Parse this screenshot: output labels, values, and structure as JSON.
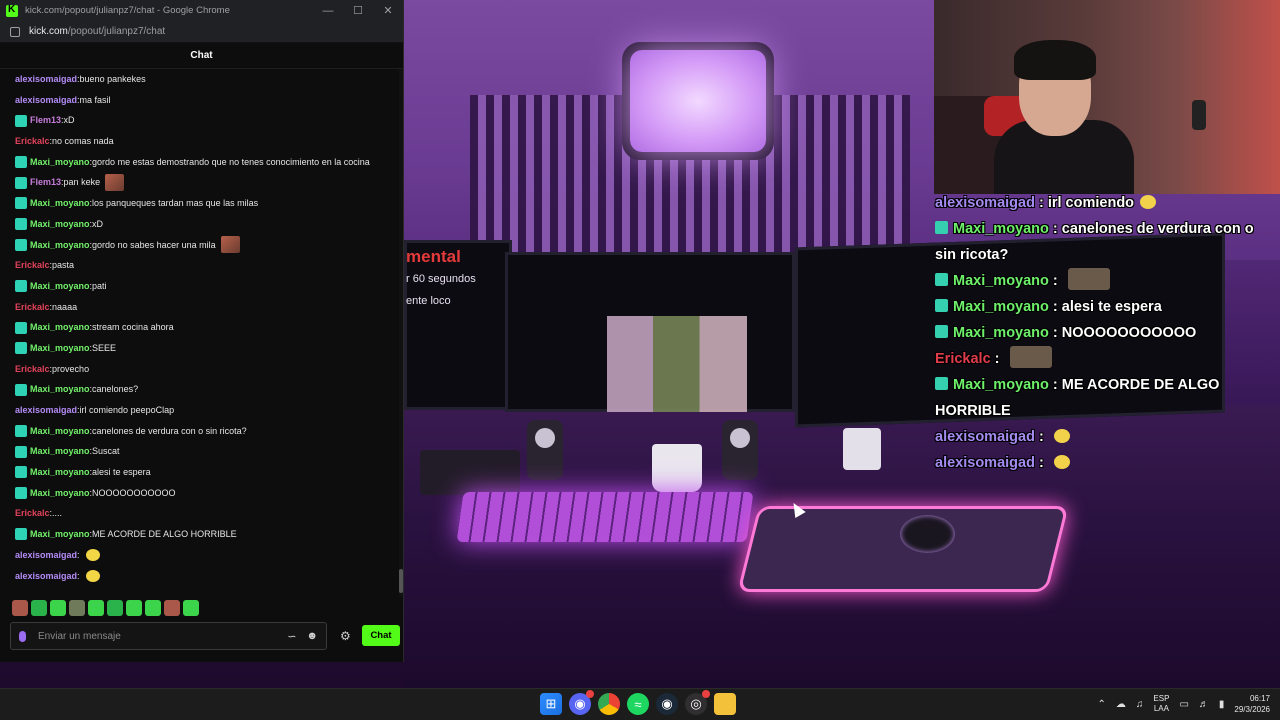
{
  "window": {
    "title": "kick.com/popout/julianpz7/chat - Google Chrome",
    "url_host": "kick.com",
    "url_path": "/popout/julianpz7/chat",
    "min_icon": "minimize-icon",
    "max_icon": "maximize-icon",
    "close_icon": "close-icon"
  },
  "chat": {
    "header": "Chat",
    "messages": [
      {
        "user": "alexisomaigad",
        "text": "bueno pankekes",
        "color": "purple",
        "badge": false,
        "emote": ""
      },
      {
        "user": "alexisomaigad",
        "text": "ma fasil",
        "color": "purple",
        "badge": false,
        "emote": ""
      },
      {
        "user": "Flem13",
        "text": "xD",
        "color": "pink",
        "badge": true,
        "emote": ""
      },
      {
        "user": "Erickalc",
        "text": "no comas nada",
        "color": "red",
        "badge": false,
        "emote": ""
      },
      {
        "user": "Maxi_moyano",
        "text": "gordo me estas demostrando que no tenes conocimiento en la cocina",
        "color": "green",
        "badge": true,
        "emote": ""
      },
      {
        "user": "Flem13",
        "text": "pan keke",
        "color": "pink",
        "badge": true,
        "emote": "img"
      },
      {
        "user": "Maxi_moyano",
        "text": "los panqueques tardan mas que las milas",
        "color": "green",
        "badge": true,
        "emote": ""
      },
      {
        "user": "Maxi_moyano",
        "text": "xD",
        "color": "green",
        "badge": true,
        "emote": ""
      },
      {
        "user": "Maxi_moyano",
        "text": "gordo no sabes hacer una mila",
        "color": "green",
        "badge": true,
        "emote": "img"
      },
      {
        "user": "Erickalc",
        "text": "pasta",
        "color": "red",
        "badge": false,
        "emote": ""
      },
      {
        "user": "Maxi_moyano",
        "text": "pati",
        "color": "green",
        "badge": true,
        "emote": ""
      },
      {
        "user": "Erickalc",
        "text": "naaaa",
        "color": "red",
        "badge": false,
        "emote": ""
      },
      {
        "user": "Maxi_moyano",
        "text": "stream cocina ahora",
        "color": "green",
        "badge": true,
        "emote": ""
      },
      {
        "user": "Maxi_moyano",
        "text": "SEEE",
        "color": "green",
        "badge": true,
        "emote": ""
      },
      {
        "user": "Erickalc",
        "text": "provecho",
        "color": "red",
        "badge": false,
        "emote": ""
      },
      {
        "user": "Maxi_moyano",
        "text": "canelones?",
        "color": "green",
        "badge": true,
        "emote": ""
      },
      {
        "user": "alexisomaigad",
        "text": "irl comiendo peepoClap",
        "color": "purple",
        "badge": false,
        "emote": ""
      },
      {
        "user": "Maxi_moyano",
        "text": "canelones de verdura con o sin ricota?",
        "color": "green",
        "badge": true,
        "emote": ""
      },
      {
        "user": "Maxi_moyano",
        "text": "Suscat",
        "color": "green",
        "badge": true,
        "emote": ""
      },
      {
        "user": "Maxi_moyano",
        "text": "alesi te espera",
        "color": "green",
        "badge": true,
        "emote": ""
      },
      {
        "user": "Maxi_moyano",
        "text": "NOOOOOOOOOOO",
        "color": "green",
        "badge": true,
        "emote": ""
      },
      {
        "user": "Erickalc",
        "text": "....",
        "color": "red",
        "badge": false,
        "emote": ""
      },
      {
        "user": "Maxi_moyano",
        "text": "ME ACORDE DE ALGO HORRIBLE",
        "color": "green",
        "badge": true,
        "emote": ""
      },
      {
        "user": "alexisomaigad",
        "text": "",
        "color": "purple",
        "badge": false,
        "emote": "yellow"
      },
      {
        "user": "alexisomaigad",
        "text": "",
        "color": "purple",
        "badge": false,
        "emote": "yellow"
      }
    ],
    "input_placeholder": "Enviar un mensaje",
    "send_label": "Chat",
    "mic_icon": "microphone-icon",
    "commands_icon": "commands-icon",
    "emoji_icon": "emoji-icon",
    "settings_icon": "gear-icon"
  },
  "stream": {
    "screen_text_1": "mental",
    "screen_text_2": "r 60 segundos",
    "screen_text_3": "ente loco",
    "overlay_chat": [
      {
        "user": "alexisomaigad",
        "text": "irl comiendo",
        "color": "purple",
        "badge": false,
        "emote": "yellow"
      },
      {
        "user": "Maxi_moyano",
        "text": "canelones de verdura con o sin ricota?",
        "color": "green",
        "badge": true,
        "emote": ""
      },
      {
        "user": "Maxi_moyano",
        "text": "",
        "color": "green",
        "badge": true,
        "emote": "img"
      },
      {
        "user": "Maxi_moyano",
        "text": "alesi te espera",
        "color": "green",
        "badge": true,
        "emote": ""
      },
      {
        "user": "Maxi_moyano",
        "text": "NOOOOOOOOOOO",
        "color": "green",
        "badge": true,
        "emote": ""
      },
      {
        "user": "Erickalc",
        "text": "",
        "color": "red",
        "badge": false,
        "emote": "img"
      },
      {
        "user": "Maxi_moyano",
        "text": "ME ACORDE DE ALGO HORRIBLE",
        "color": "green",
        "badge": true,
        "emote": ""
      },
      {
        "user": "alexisomaigad",
        "text": "",
        "color": "purple",
        "badge": false,
        "emote": "yellow"
      },
      {
        "user": "alexisomaigad",
        "text": "",
        "color": "purple",
        "badge": false,
        "emote": "yellow"
      }
    ]
  },
  "taskbar": {
    "apps": [
      "windows-start-icon",
      "discord-icon",
      "chrome-icon",
      "spotify-icon",
      "steam-icon",
      "obs-icon",
      "file-explorer-icon"
    ],
    "lang_top": "ESP",
    "lang_bottom": "LAA",
    "time": "06:17",
    "date": "29/3/2026"
  },
  "colors": {
    "kick_green": "#53fc18",
    "user_green": "#72f16a",
    "user_purple": "#b48cf6",
    "user_red": "#e0425a",
    "user_pink": "#c77ddb"
  }
}
